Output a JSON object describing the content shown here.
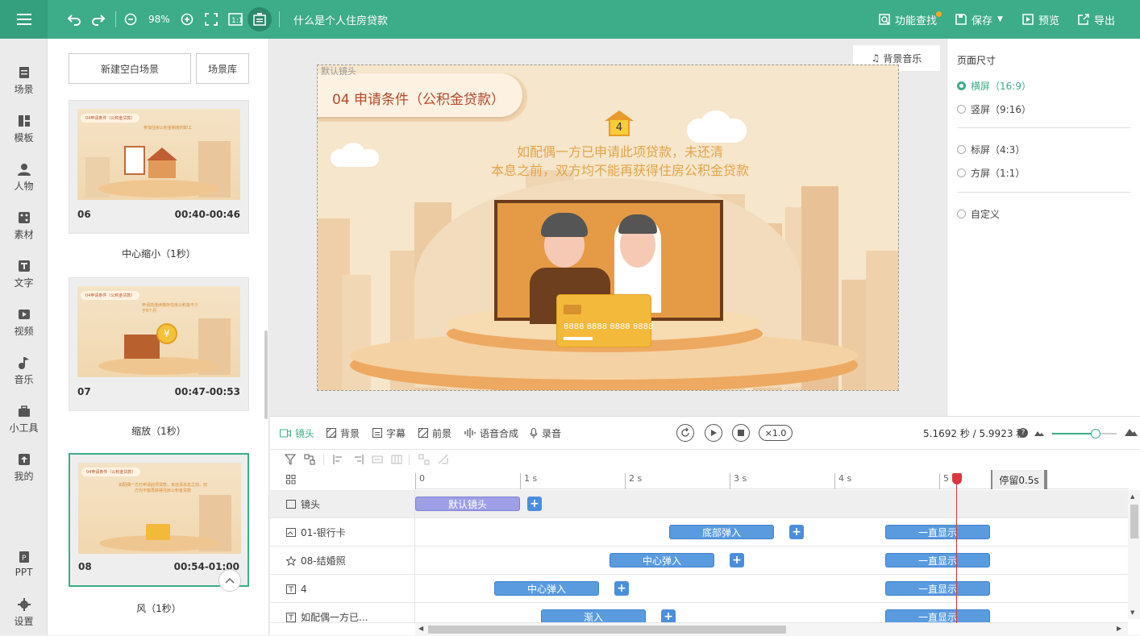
{
  "toolbar": {
    "zoom": "98%",
    "doc_title": "什么是个人住房贷款",
    "find": "功能查找",
    "save": "保存",
    "preview": "预览",
    "export": "导出"
  },
  "left_nav": [
    {
      "label": "场景",
      "icon": "scene-icon"
    },
    {
      "label": "模板",
      "icon": "template-icon"
    },
    {
      "label": "人物",
      "icon": "person-icon"
    },
    {
      "label": "素材",
      "icon": "material-icon"
    },
    {
      "label": "文字",
      "icon": "text-icon"
    },
    {
      "label": "视频",
      "icon": "video-icon"
    },
    {
      "label": "音乐",
      "icon": "music-icon"
    },
    {
      "label": "小工具",
      "icon": "toolbox-icon"
    },
    {
      "label": "我的",
      "icon": "upload-icon"
    },
    {
      "label": "PPT",
      "icon": "ppt-icon"
    },
    {
      "label": "设置",
      "icon": "gear-icon"
    }
  ],
  "scene_panel": {
    "new_blank": "新建空白场景",
    "library": "场景库",
    "cards": [
      {
        "num": "06",
        "time": "00:40-00:46",
        "transition": "中心缩小（1秒）",
        "thumb_title": "04申请条件（公积金贷款）",
        "thumb_text": "参加住房公积金制度的职工"
      },
      {
        "num": "07",
        "time": "00:47-00:53",
        "transition": "缩放（1秒）",
        "thumb_title": "04申请条件（公积金贷款）",
        "thumb_text": "申请前连续缴存住房公积金不少于6个月"
      },
      {
        "num": "08",
        "time": "00:54-01:00",
        "transition": "风（1秒）",
        "thumb_title": "04申请条件（公积金贷款）",
        "thumb_text": "如配偶一方已申请此项贷款，未还清本息之前，双方均不能再获得住房公积金贷款"
      }
    ]
  },
  "stage": {
    "bg_music": "背景音乐",
    "camera_label": "默认镜头",
    "slide_title": "04 申请条件（公积金贷款）",
    "badge_number": "4",
    "body_line1": "如配偶一方已申请此项贷款，未还清",
    "body_line2": "本息之前，双方均不能再获得住房公积金贷款",
    "card_number": "8888 8888 8888 8888"
  },
  "page_size": {
    "title": "页面尺寸",
    "options": [
      {
        "label": "横屏（16:9）",
        "selected": true
      },
      {
        "label": "竖屏（9:16）",
        "selected": false
      },
      {
        "label": "标屏（4:3）",
        "selected": false
      },
      {
        "label": "方屏（1:1）",
        "selected": false
      },
      {
        "label": "自定义",
        "selected": false
      }
    ]
  },
  "timeline": {
    "tabs": [
      "镜头",
      "背景",
      "字幕",
      "前景",
      "语音合成",
      "录音"
    ],
    "speed": "×1.0",
    "time_readout": "5.1692 秒 / 5.9923 秒",
    "ruler": [
      "0",
      "1 s",
      "2 s",
      "3 s",
      "4 s",
      "5"
    ],
    "hold": "停留0.5s",
    "playhead_seconds": 5.1692,
    "rows": [
      {
        "label": "镜头",
        "clips": [
          {
            "text": "默认镜头"
          }
        ]
      },
      {
        "label": "01-银行卡",
        "clips": [
          {
            "text": "底部弹入"
          },
          {
            "text": "一直显示"
          }
        ]
      },
      {
        "label": "08-结婚照",
        "clips": [
          {
            "text": "中心弹入"
          },
          {
            "text": "一直显示"
          }
        ]
      },
      {
        "label": "4",
        "clips": [
          {
            "text": "中心弹入"
          },
          {
            "text": "一直显示"
          }
        ]
      },
      {
        "label": "如配偶一方已...",
        "clips": [
          {
            "text": "渐入"
          },
          {
            "text": "一直显示"
          }
        ]
      }
    ]
  },
  "colors": {
    "brand": "#3dac88",
    "clip": "#5a9be0",
    "playhead": "#d9363e"
  }
}
